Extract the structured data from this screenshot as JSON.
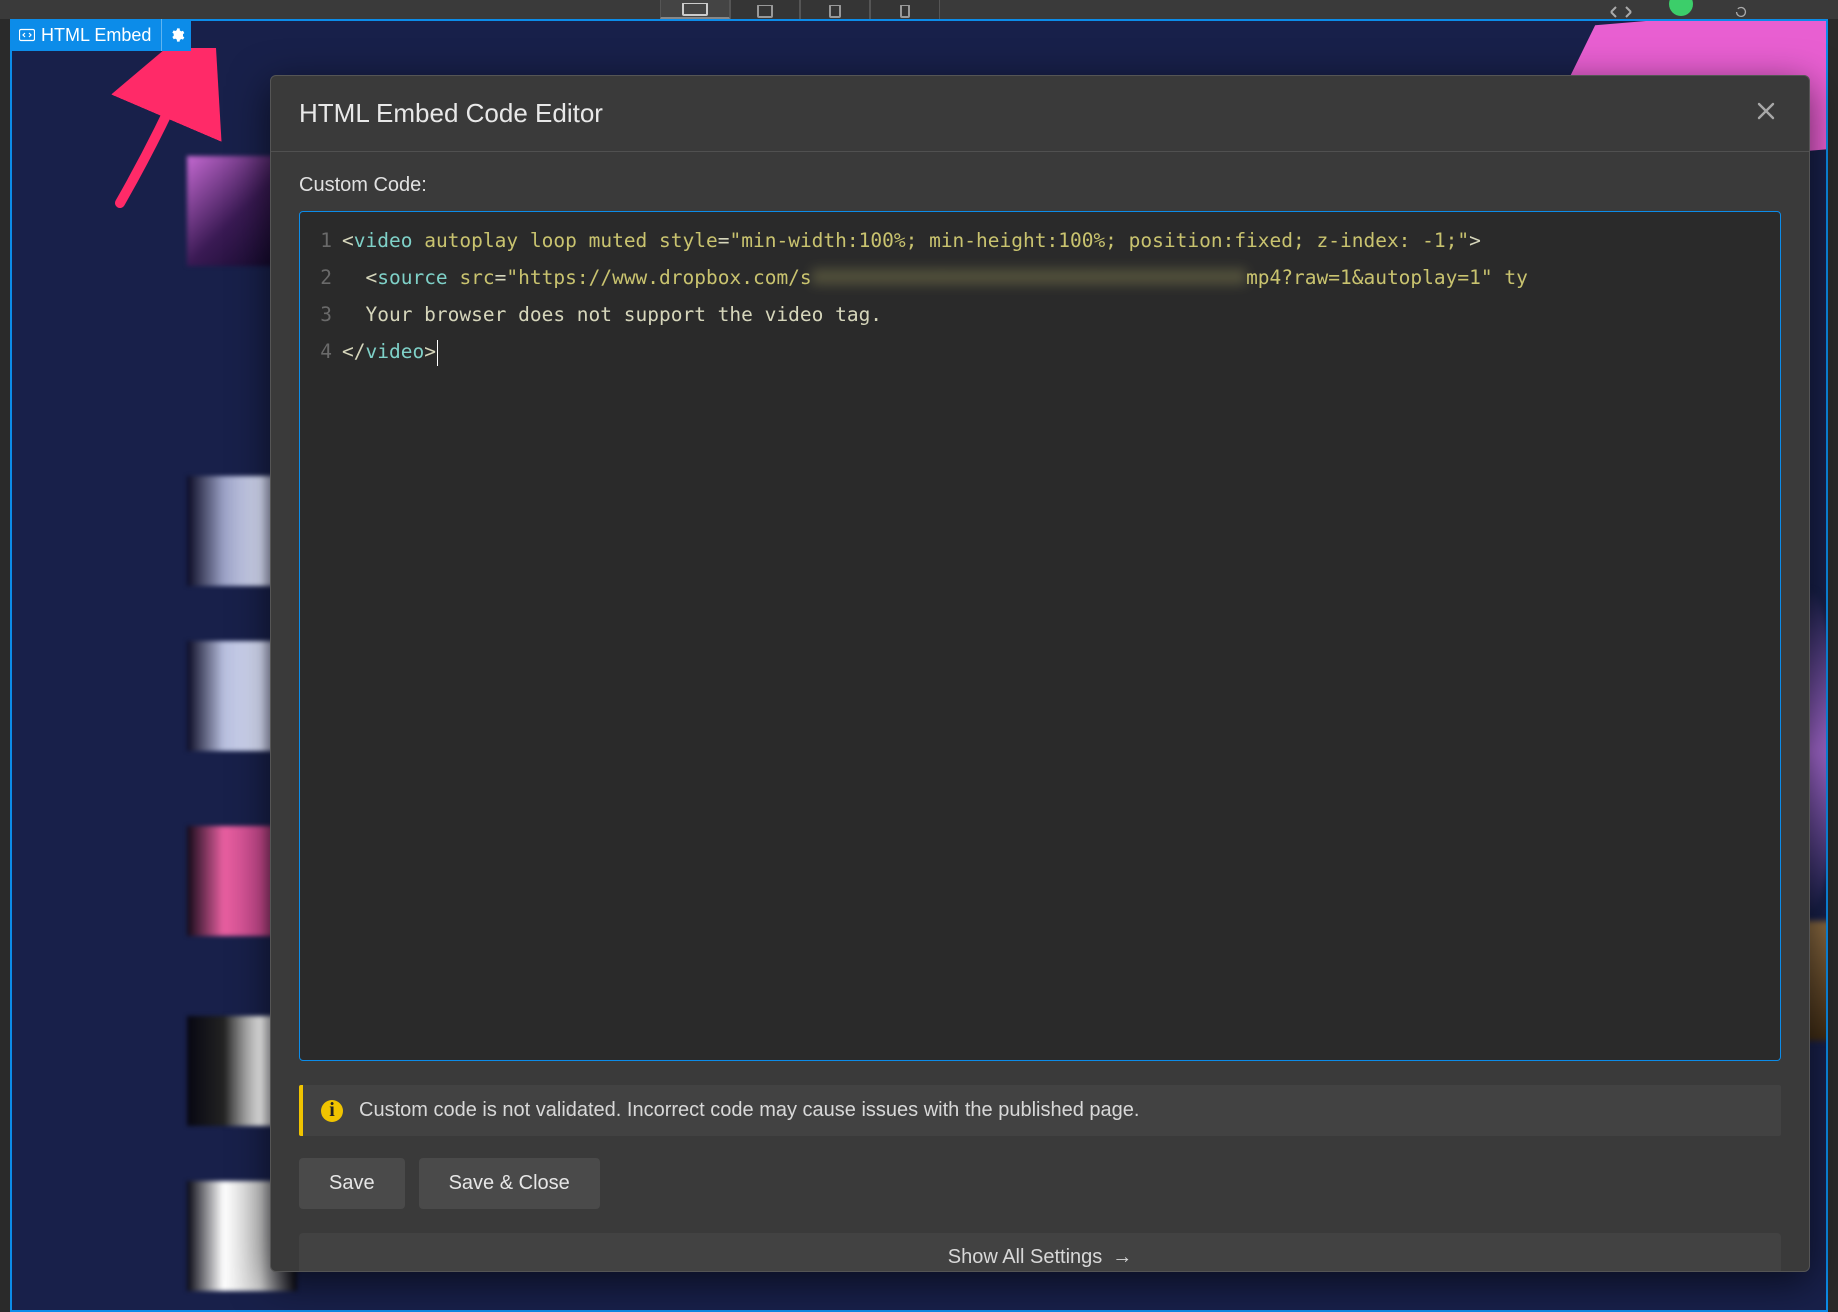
{
  "element_tag": {
    "label": "HTML Embed",
    "icon": "code-embed-icon",
    "gear_icon": "gear-icon"
  },
  "dialog": {
    "title": "HTML Embed Code Editor",
    "close_icon": "close-icon",
    "field_label": "Custom Code:",
    "code": {
      "line_numbers": [
        "1",
        "2",
        "3",
        "4"
      ],
      "lines": {
        "l1_open": "<",
        "l1_tag": "video",
        "l1_sp": " ",
        "l1_a1": "autoplay",
        "l1_a2": "loop",
        "l1_a3": "muted",
        "l1_a4": "style",
        "l1_eq": "=",
        "l1_str": "\"min-width:100%; min-height:100%; position:fixed; z-index: -1;\"",
        "l1_close": ">",
        "l2_indent": "  ",
        "l2_open": "<",
        "l2_tag": "source",
        "l2_a1": "src",
        "l2_eq": "=",
        "l2_str_a": "\"https://www.dropbox.com/s",
        "l2_str_blur": "XXXXXXXXXXXXXXXXXXXXXXXXXXXXXXXXXXXXX",
        "l2_str_b": "mp4?raw=1&autoplay=1\"",
        "l2_a2": "ty",
        "l3_indent": "  ",
        "l3_text": "Your browser does not support the video tag.",
        "l4_open": "</",
        "l4_tag": "video",
        "l4_close": ">"
      }
    },
    "warning": {
      "icon_char": "i",
      "text": "Custom code is not validated. Incorrect code may cause issues with the published page."
    },
    "buttons": {
      "save": "Save",
      "save_close": "Save & Close"
    },
    "show_all": "Show All Settings",
    "show_all_arrow": "→"
  },
  "colors": {
    "accent": "#0c8ce9",
    "warn": "#f0c400",
    "pink": "#e85fd1"
  }
}
